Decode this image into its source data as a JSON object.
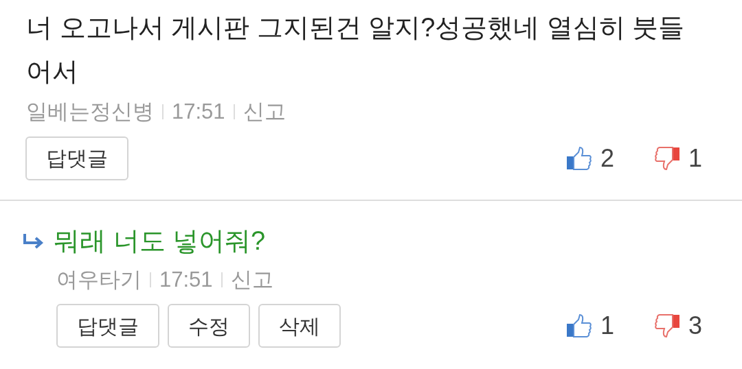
{
  "comments": [
    {
      "kind": "comment",
      "text": "너 오고나서 게시판 그지된건 알지?성공했네 열심히 붓들어서",
      "author": "일베는정신병",
      "time": "17:51",
      "report": "신고",
      "buttons": [
        "답댓글"
      ],
      "likes": "2",
      "dislikes": "1"
    },
    {
      "kind": "reply",
      "text": "뭐래 너도 넣어줘?",
      "author": "여우타기",
      "time": "17:51",
      "report": "신고",
      "buttons": [
        "답댓글",
        "수정",
        "삭제"
      ],
      "likes": "1",
      "dislikes": "3"
    }
  ]
}
